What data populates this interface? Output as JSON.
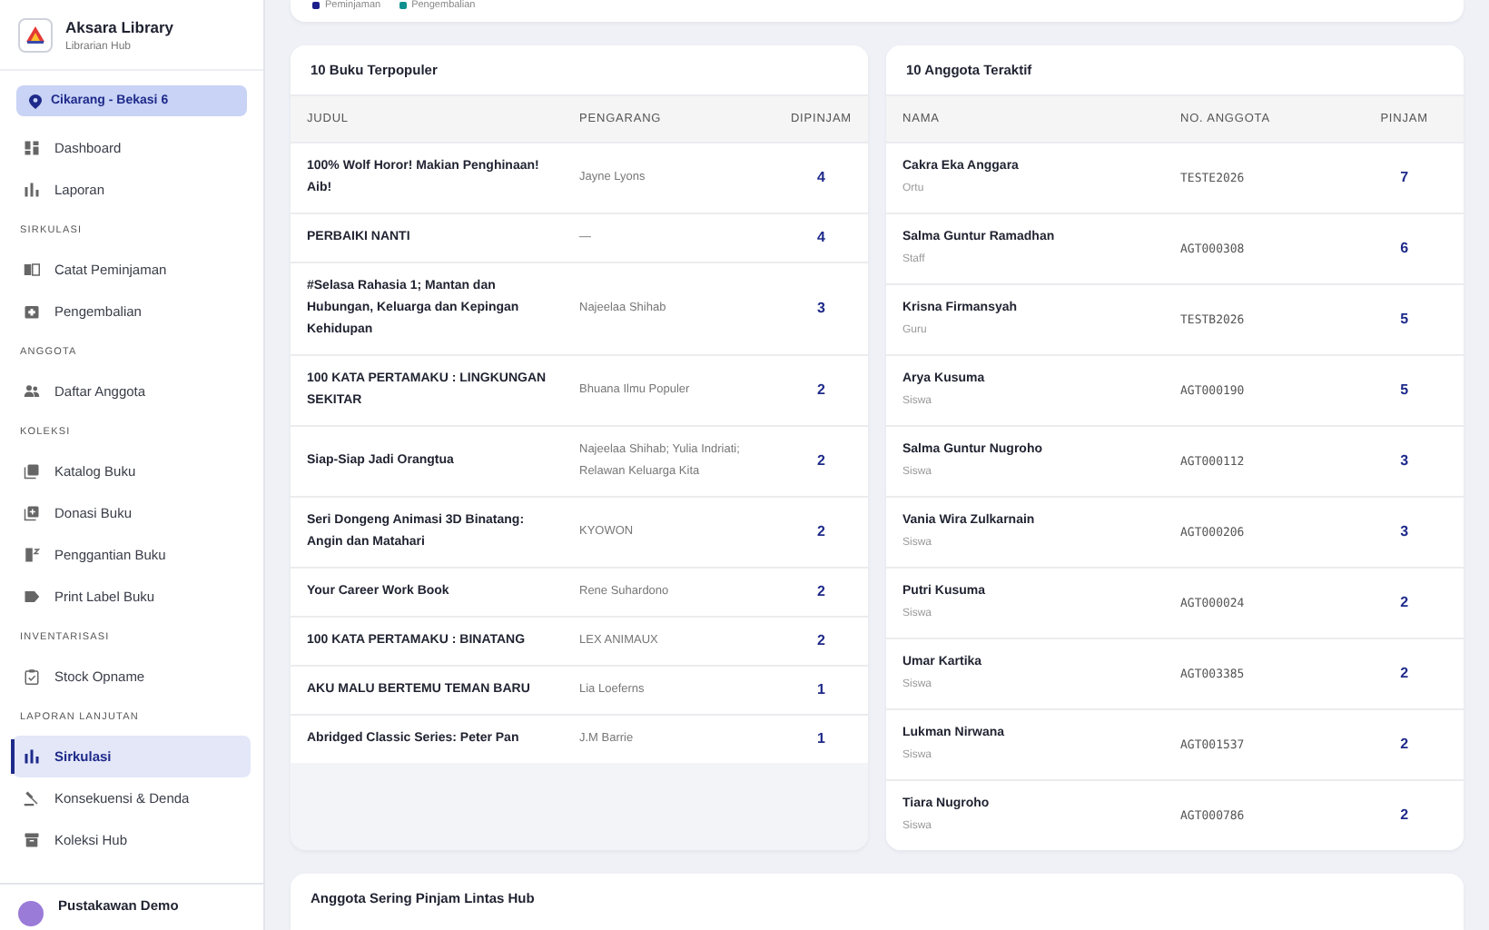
{
  "sidebar": {
    "brand": {
      "title": "Aksara Library",
      "subtitle": "Librarian Hub"
    },
    "location": "Cikarang - Bekasi 6",
    "nav": [
      {
        "kind": "link",
        "label": "Dashboard",
        "selected": false
      },
      {
        "kind": "link",
        "label": "Laporan",
        "selected": false
      },
      {
        "kind": "heading",
        "label": "SIRKULASI"
      },
      {
        "kind": "link",
        "label": "Catat Peminjaman",
        "selected": false
      },
      {
        "kind": "link",
        "label": "Pengembalian",
        "selected": false
      },
      {
        "kind": "heading",
        "label": "ANGGOTA"
      },
      {
        "kind": "link",
        "label": "Daftar Anggota",
        "selected": false
      },
      {
        "kind": "heading",
        "label": "KOLEKSI"
      },
      {
        "kind": "link",
        "label": "Katalog Buku",
        "selected": false
      },
      {
        "kind": "link",
        "label": "Donasi Buku",
        "selected": false
      },
      {
        "kind": "link",
        "label": "Penggantian Buku",
        "selected": false
      },
      {
        "kind": "link",
        "label": "Print Label Buku",
        "selected": false
      },
      {
        "kind": "heading",
        "label": "INVENTARISASI"
      },
      {
        "kind": "link",
        "label": "Stock Opname",
        "selected": false
      },
      {
        "kind": "heading",
        "label": "LAPORAN LANJUTAN"
      },
      {
        "kind": "link",
        "label": "Sirkulasi",
        "selected": true
      },
      {
        "kind": "link",
        "label": "Konsekuensi & Denda",
        "selected": false
      },
      {
        "kind": "link",
        "label": "Koleksi Hub",
        "selected": false
      }
    ],
    "user": {
      "name": "Pustakawan Demo"
    }
  },
  "chart_legend": [
    {
      "label": "Peminjaman",
      "color": "#1a1f8c"
    },
    {
      "label": "Pengembalian",
      "color": "#0f8f8f"
    }
  ],
  "popular_books": {
    "title": "10 Buku Terpopuler",
    "columns": [
      "JUDUL",
      "PENGARANG",
      "DIPINJAM"
    ],
    "rows": [
      {
        "title": "100% Wolf Horor! Makian Penghinaan! Aib!",
        "author": "Jayne Lyons",
        "count": "4"
      },
      {
        "title": "PERBAIKI NANTI",
        "author": "—",
        "count": "4"
      },
      {
        "title": "#Selasa Rahasia 1; Mantan dan Hubungan, Keluarga dan Kepingan Kehidupan",
        "author": "Najeelaa Shihab",
        "count": "3"
      },
      {
        "title": "100 KATA PERTAMAKU : LINGKUNGAN SEKITAR",
        "author": "Bhuana Ilmu Populer",
        "count": "2"
      },
      {
        "title": "Siap-Siap Jadi Orangtua",
        "author": "Najeelaa Shihab; Yulia Indriati; Relawan Keluarga Kita",
        "count": "2"
      },
      {
        "title": "Seri Dongeng Animasi 3D Binatang: Angin dan Matahari",
        "author": "KYOWON",
        "count": "2"
      },
      {
        "title": "Your Career Work Book",
        "author": "Rene Suhardono",
        "count": "2"
      },
      {
        "title": "100 KATA PERTAMAKU : BINATANG",
        "author": "LEX ANIMAUX",
        "count": "2"
      },
      {
        "title": "AKU MALU BERTEMU TEMAN BARU",
        "author": "Lia Loeferns",
        "count": "1"
      },
      {
        "title": "Abridged Classic Series: Peter Pan",
        "author": "J.M Barrie",
        "count": "1"
      }
    ]
  },
  "active_members": {
    "title": "10 Anggota Teraktif",
    "columns": [
      "NAMA",
      "NO. ANGGOTA",
      "PINJAM"
    ],
    "rows": [
      {
        "name": "Cakra Eka Anggara",
        "role": "Ortu",
        "number": "TESTE2026",
        "count": "7"
      },
      {
        "name": "Salma Guntur Ramadhan",
        "role": "Staff",
        "number": "AGT000308",
        "count": "6"
      },
      {
        "name": "Krisna Firmansyah",
        "role": "Guru",
        "number": "TESTB2026",
        "count": "5"
      },
      {
        "name": "Arya Kusuma",
        "role": "Siswa",
        "number": "AGT000190",
        "count": "5"
      },
      {
        "name": "Salma Guntur Nugroho",
        "role": "Siswa",
        "number": "AGT000112",
        "count": "3"
      },
      {
        "name": "Vania Wira Zulkarnain",
        "role": "Siswa",
        "number": "AGT000206",
        "count": "3"
      },
      {
        "name": "Putri Kusuma",
        "role": "Siswa",
        "number": "AGT000024",
        "count": "2"
      },
      {
        "name": "Umar Kartika",
        "role": "Siswa",
        "number": "AGT003385",
        "count": "2"
      },
      {
        "name": "Lukman Nirwana",
        "role": "Siswa",
        "number": "AGT001537",
        "count": "2"
      },
      {
        "name": "Tiara Nugroho",
        "role": "Siswa",
        "number": "AGT000786",
        "count": "2"
      }
    ]
  },
  "cross_hub": {
    "title": "Anggota Sering Pinjam Lintas Hub"
  }
}
